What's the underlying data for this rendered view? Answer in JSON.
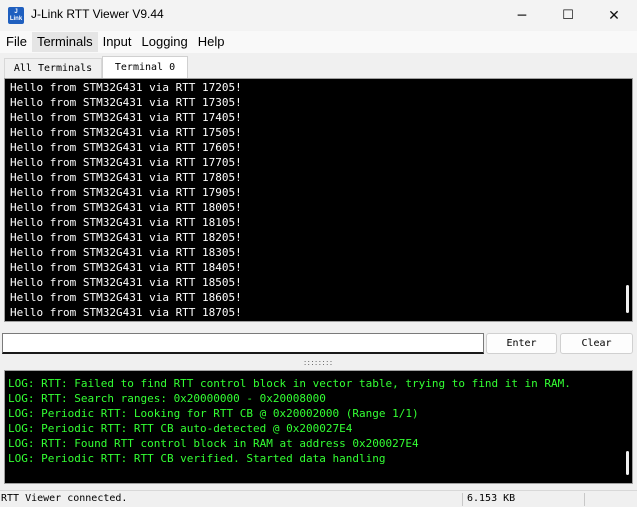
{
  "window": {
    "title": "J-Link RTT Viewer V9.44",
    "icon_text": [
      "J",
      "Link"
    ],
    "controls": {
      "minimize": "─",
      "maximize": "☐",
      "close": "✕"
    }
  },
  "menu": {
    "items": [
      "File",
      "Terminals",
      "Input",
      "Logging",
      "Help"
    ]
  },
  "tabs": [
    "All Terminals",
    "Terminal 0"
  ],
  "terminal": {
    "lines": [
      "Hello from STM32G431 via RTT 17205!",
      "Hello from STM32G431 via RTT 17305!",
      "Hello from STM32G431 via RTT 17405!",
      "Hello from STM32G431 via RTT 17505!",
      "Hello from STM32G431 via RTT 17605!",
      "Hello from STM32G431 via RTT 17705!",
      "Hello from STM32G431 via RTT 17805!",
      "Hello from STM32G431 via RTT 17905!",
      "Hello from STM32G431 via RTT 18005!",
      "Hello from STM32G431 via RTT 18105!",
      "Hello from STM32G431 via RTT 18205!",
      "Hello from STM32G431 via RTT 18305!",
      "Hello from STM32G431 via RTT 18405!",
      "Hello from STM32G431 via RTT 18505!",
      "Hello from STM32G431 via RTT 18605!",
      "Hello from STM32G431 via RTT 18705!"
    ]
  },
  "input": {
    "value": "",
    "enter_label": "Enter",
    "clear_label": "Clear"
  },
  "splitter": {
    "grip": "::::::::"
  },
  "log": {
    "lines": [
      "LOG: RTT: Failed to find RTT control block in vector table, trying to find it in RAM.",
      "LOG: RTT: Search ranges: 0x20000000 - 0x20008000",
      "LOG: Periodic RTT: Looking for RTT CB @ 0x20002000 (Range 1/1)",
      "LOG: Periodic RTT: RTT CB auto-detected @ 0x200027E4",
      "LOG: RTT: Found RTT control block in RAM at address 0x200027E4",
      "LOG: Periodic RTT: RTT CB verified. Started data handling"
    ]
  },
  "status": {
    "message": "RTT Viewer connected.",
    "data_size": "6.153 KB"
  },
  "colors": {
    "terminal_text": "#ffffff",
    "log_text": "#33ff33",
    "console_bg": "#000000"
  }
}
